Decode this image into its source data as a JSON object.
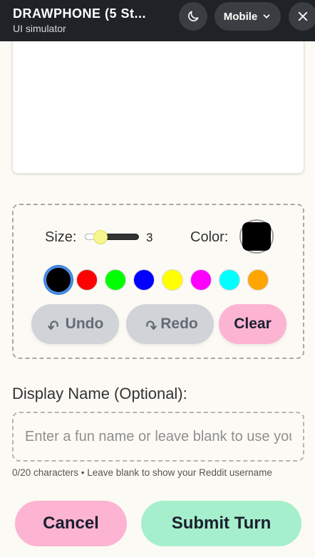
{
  "header": {
    "title": "DRAWPHONE (5 St...",
    "subtitle": "UI simulator",
    "mode_label": "Mobile",
    "icons": {
      "theme": "moon-icon",
      "mode": "chevron-down-icon",
      "close": "close-icon"
    }
  },
  "tools": {
    "size_label": "Size:",
    "size_value": "3",
    "size_min": 1,
    "size_max": 10,
    "color_label": "Color:",
    "current_color": "#000000",
    "swatches": [
      "#000000",
      "#ff0000",
      "#00ff00",
      "#0000ff",
      "#ffff00",
      "#ff00ff",
      "#00ffff",
      "#ffa500"
    ],
    "selected_swatch": "#000000",
    "undo_label": "Undo",
    "redo_label": "Redo",
    "clear_label": "Clear",
    "undo_icon": "undo-icon",
    "redo_icon": "redo-icon"
  },
  "display_name": {
    "label": "Display Name (Optional):",
    "value": "",
    "placeholder": "Enter a fun name or leave blank to use your Reddit username",
    "hint": "0/20 characters • Leave blank to show your Reddit username"
  },
  "actions": {
    "cancel_label": "Cancel",
    "submit_label": "Submit Turn"
  },
  "colors": {
    "cancel_bg": "#fdb4d2",
    "submit_bg": "#a6efcc",
    "clear_bg": "#fdb4d2",
    "header_bg": "#1f2226"
  }
}
